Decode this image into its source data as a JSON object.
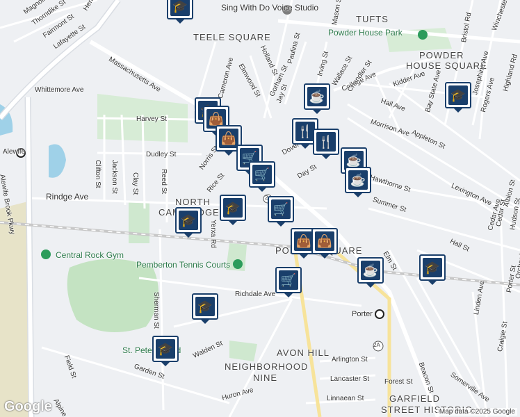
{
  "map": {
    "neighborhoods": [
      "TEELE SQUARE",
      "TUFTS",
      "POWDER",
      "HOUSE SQUARE",
      "NORTH",
      "CAMBRIDGE",
      "PORTER SQUARE",
      "AVON HILL",
      "NEIGHBORHOOD",
      "NINE",
      "GARFIELD",
      "STREET HISTORIC"
    ],
    "streets": [
      "Alewife Brook Pkwy",
      "Massachusetts Ave",
      "Whittemore Ave",
      "Harvey St",
      "Dudley St",
      "Norris St",
      "Rice St",
      "Rindge Ave",
      "Clifton St",
      "Jackson St",
      "Clay St",
      "Reed St",
      "Yerxa Rd",
      "Richdale Ave",
      "Sherman St",
      "Field St",
      "Garden St",
      "Walden St",
      "Huron Ave",
      "Alpine St",
      "Linnaean St",
      "Lancaster St",
      "Arlington St",
      "Forest St",
      "Beacon St",
      "Somerville Ave",
      "Elm St",
      "College Ave",
      "Kidder Ave",
      "Hall Ave",
      "Morrison Ave",
      "Appleton St",
      "Lexington Ave",
      "Highland Rd",
      "Rogers Ave",
      "Josephine Ave",
      "Bay State Ave",
      "Holland St",
      "Paulina St",
      "Jay St",
      "Gorham St",
      "Elmwood St",
      "Irving St",
      "Wallace St",
      "Chandler St",
      "Mason St",
      "Bristol Rd",
      "Winchester St",
      "Hawthorne St",
      "Linden Ave",
      "Craigie St",
      "Porter St",
      "Hudson St",
      "Cedar St",
      "Orchard St",
      "Cameron Ave",
      "Day St",
      "Dover St",
      "Magnolia Ave",
      "Thorndike St",
      "Fairmont St",
      "Lafayette St",
      "Henderson St",
      "Summer St",
      "Cedar Ave",
      "Albion St",
      "Hall St"
    ],
    "pois": [
      "Sing With Do Voice Studio",
      "Powder House Park",
      "Central Rock Gym",
      "Pemberton Tennis Courts",
      "St. Peter's Field"
    ],
    "stations": [
      "Alewife",
      "Porter"
    ],
    "route_shields": [
      "2",
      "2A"
    ],
    "brand": "Google",
    "attribution": "Map data ©2025 Google"
  },
  "colors": {
    "road": "#ffffff",
    "background": "#eef0f3",
    "park": "#cfe8cf",
    "water": "#9fd1e8",
    "pin": "#1a3f6b",
    "rail": "#c8c8c8"
  },
  "pins": [
    {
      "type": "school",
      "icon": "school-icon"
    },
    {
      "type": "school",
      "icon": "school-icon"
    },
    {
      "type": "shopping",
      "icon": "shopping-bag-icon"
    },
    {
      "type": "shopping",
      "icon": "shopping-bag-icon"
    },
    {
      "type": "grocery",
      "icon": "shopping-cart-icon"
    },
    {
      "type": "grocery",
      "icon": "shopping-cart-icon"
    },
    {
      "type": "grocery",
      "icon": "shopping-cart-icon"
    },
    {
      "type": "school",
      "icon": "school-icon"
    },
    {
      "type": "school",
      "icon": "school-icon"
    },
    {
      "type": "cafe",
      "icon": "coffee-cup-icon"
    },
    {
      "type": "restaurant",
      "icon": "fork-knife-icon"
    },
    {
      "type": "restaurant",
      "icon": "fork-knife-icon"
    },
    {
      "type": "cafe",
      "icon": "coffee-cup-icon"
    },
    {
      "type": "cafe",
      "icon": "coffee-cup-icon"
    },
    {
      "type": "shopping",
      "icon": "shopping-bag-icon"
    },
    {
      "type": "shopping",
      "icon": "shopping-bag-icon"
    },
    {
      "type": "cafe",
      "icon": "coffee-cup-icon"
    },
    {
      "type": "school",
      "icon": "school-icon"
    },
    {
      "type": "grocery",
      "icon": "shopping-cart-icon"
    },
    {
      "type": "school",
      "icon": "school-icon"
    },
    {
      "type": "school",
      "icon": "school-icon"
    },
    {
      "type": "school",
      "icon": "school-icon"
    }
  ]
}
